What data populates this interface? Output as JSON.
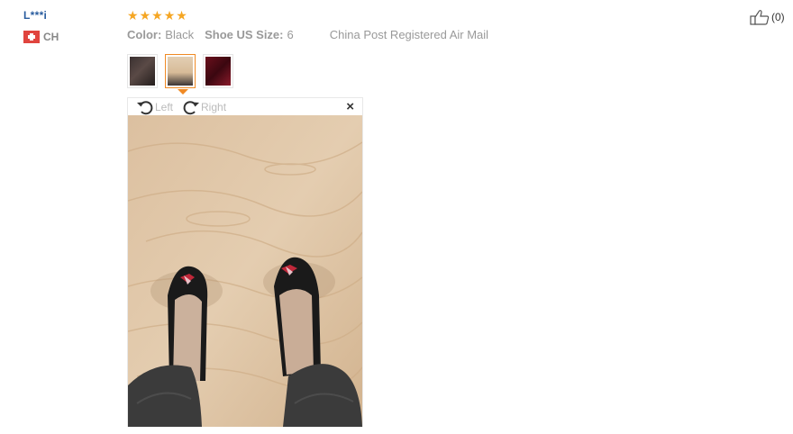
{
  "review": {
    "user_name": "L***i",
    "country_code": "CH",
    "rating": 5,
    "color_label": "Color:",
    "color_value": "Black",
    "size_label": "Shoe US Size:",
    "size_value": "6",
    "shipping": "China Post Registered Air Mail",
    "likes": "(0)"
  },
  "viewer": {
    "rotate_left": "Left",
    "rotate_right": "Right",
    "close_symbol": "×",
    "thumbnails": [
      "photo-1",
      "photo-2",
      "photo-3"
    ],
    "active_thumbnail": 1
  },
  "icons": {
    "star": "star-icon",
    "like": "thumbs-up-icon",
    "flag": "swiss-flag-icon",
    "rotate_left": "rotate-left-icon",
    "rotate_right": "rotate-right-icon",
    "close": "close-icon"
  },
  "colors": {
    "star": "#f5a623",
    "user_link": "#2a5d9f",
    "active_border": "#f08a24"
  }
}
